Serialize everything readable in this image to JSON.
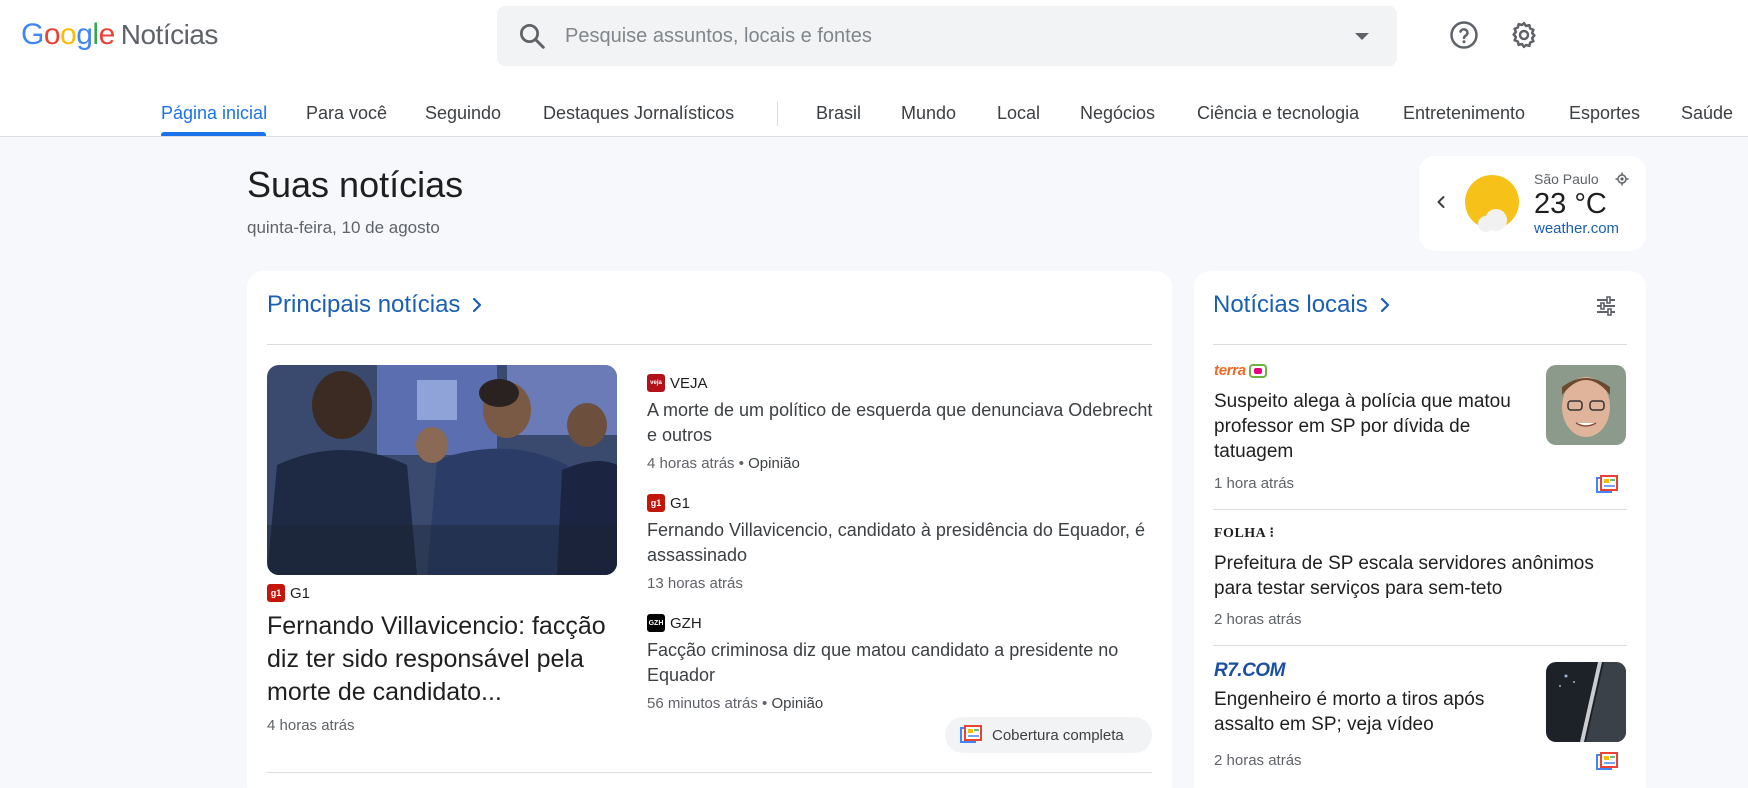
{
  "app": {
    "logo_letters": [
      "G",
      "o",
      "o",
      "g",
      "l",
      "e"
    ],
    "product_name": "Notícias"
  },
  "search": {
    "placeholder": "Pesquise assuntos, locais e fontes"
  },
  "header_icons": [
    "search-icon",
    "help-icon",
    "gear-icon",
    "chevron-down-icon"
  ],
  "nav": {
    "items": [
      {
        "label": "Página inicial",
        "active": true
      },
      {
        "label": "Para você"
      },
      {
        "label": "Seguindo"
      },
      {
        "label": "Destaques Jornalísticos"
      },
      {
        "label": "Brasil"
      },
      {
        "label": "Mundo"
      },
      {
        "label": "Local"
      },
      {
        "label": "Negócios"
      },
      {
        "label": "Ciência e tecnologia"
      },
      {
        "label": "Entretenimento"
      },
      {
        "label": "Esportes"
      },
      {
        "label": "Saúde"
      }
    ]
  },
  "page": {
    "title": "Suas notícias",
    "date": "quinta-feira, 10 de agosto"
  },
  "weather": {
    "city": "São Paulo",
    "temp": "23 °C",
    "source": "weather.com"
  },
  "top_stories": {
    "heading": "Principais notícias",
    "hero": {
      "source": "G1",
      "title": "Fernando Villavicencio: facção diz ter sido responsável pela morte de candidato...",
      "time": "4 horas atrás"
    },
    "items": [
      {
        "source": "VEJA",
        "title": "A morte de um político de esquerda que denunciava Odebrecht e outros",
        "time": "4 horas atrás",
        "tag": "Opinião"
      },
      {
        "source": "G1",
        "title": "Fernando Villavicencio, candidato à presidência do Equador, é assassinado",
        "time": "13 horas atrás"
      },
      {
        "source": "GZH",
        "title": "Facção criminosa diz que matou candidato a presidente no Equador",
        "time": "56 minutos atrás",
        "tag": "Opinião"
      }
    ],
    "coverage_label": "Cobertura completa",
    "colors": {
      "g1": "#c4170c",
      "veja": "#b3121b",
      "gzh": "#000000",
      "link": "#1a5fb4"
    }
  },
  "local_news": {
    "heading": "Notícias locais",
    "items": [
      {
        "source": "terra",
        "title": "Suspeito alega à polícia que matou professor em SP por dívida de tatuagem",
        "time": "1 hora atrás"
      },
      {
        "source": "FOLHA",
        "title": "Prefeitura de SP escala servidores anônimos para testar serviços para sem-teto",
        "time": "2 horas atrás"
      },
      {
        "source": "R7.COM",
        "title": "Engenheiro é morto a tiros após assalto em SP; veja vídeo",
        "time": "2 horas atrás"
      }
    ]
  }
}
